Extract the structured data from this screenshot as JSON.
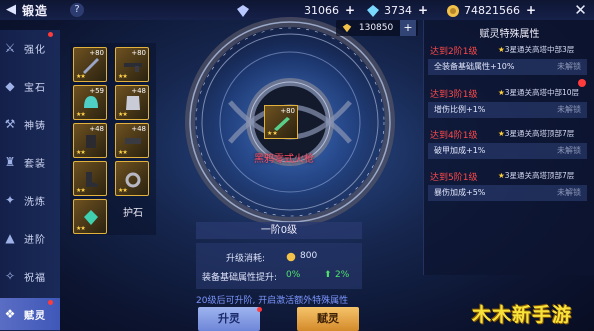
{
  "header": {
    "title": "锻造",
    "help": "?"
  },
  "currencies": [
    {
      "icon": "diamond-icon",
      "value": "31066",
      "color": "#b9c8ff"
    },
    {
      "icon": "gem-icon",
      "value": "3734",
      "color": "#7ad9ff"
    },
    {
      "icon": "coin-icon",
      "value": "74821566",
      "color": "#f2c14a"
    }
  ],
  "secondary_currency": {
    "icon": "diamond-icon",
    "value": "130850"
  },
  "side_menu": [
    {
      "label": "强化",
      "icon": "sword-icon",
      "active": false,
      "dot": true
    },
    {
      "label": "宝石",
      "icon": "gem-icon",
      "active": false,
      "dot": false
    },
    {
      "label": "神铸",
      "icon": "anvil-icon",
      "active": false,
      "dot": false
    },
    {
      "label": "套装",
      "icon": "armor-icon",
      "active": false,
      "dot": false
    },
    {
      "label": "洗炼",
      "icon": "refine-icon",
      "active": false,
      "dot": false
    },
    {
      "label": "进阶",
      "icon": "advance-icon",
      "active": false,
      "dot": false
    },
    {
      "label": "祝福",
      "icon": "bless-icon",
      "active": false,
      "dot": false
    },
    {
      "label": "赋灵",
      "icon": "spirit-icon",
      "active": true,
      "dot": true
    }
  ],
  "items": [
    {
      "level": "+80",
      "stars": "★★"
    },
    {
      "level": "+80",
      "stars": "★★"
    },
    {
      "level": "+59",
      "stars": "★★"
    },
    {
      "level": "+48",
      "stars": "★★"
    },
    {
      "level": "+48",
      "stars": "★★"
    },
    {
      "level": "+48",
      "stars": "★★"
    },
    {
      "level": "",
      "stars": "★★"
    },
    {
      "level": "",
      "stars": "★★"
    },
    {
      "level": "",
      "stars": "★★"
    }
  ],
  "protect_stone": "护石",
  "center": {
    "item_level": "+80",
    "item_stars": "★★",
    "item_name": "黑鸦零式火枪"
  },
  "stage": "一阶0级",
  "cost": {
    "label": "升级消耗:",
    "value": "800",
    "attr_label": "装备基础属性提升:",
    "current": "0%",
    "next": "2%"
  },
  "hint": "20级后可升阶, 开启激活额外特殊属性",
  "buttons": {
    "ascend": "升灵",
    "fuse": "赋灵"
  },
  "right_panel": {
    "title": "赋灵特殊属性",
    "attributes": [
      {
        "tier": "达到2阶1级",
        "condition": "3星通关高塔中部3层",
        "effect": "全装备基础属性+10%",
        "status": "未解锁"
      },
      {
        "tier": "达到3阶1级",
        "condition": "3星通关高塔中部10层",
        "effect": "增伤比例+1%",
        "status": "未解锁"
      },
      {
        "tier": "达到4阶1级",
        "condition": "3星通关高塔顶部7层",
        "effect": "破甲加成+1%",
        "status": "未解锁"
      },
      {
        "tier": "达到5阶1级",
        "condition": "3星通关高塔顶部7层",
        "effect": "暴伤加成+5%",
        "status": "未解锁"
      }
    ]
  },
  "watermark": "木木新手游",
  "colors": {
    "accent_red": "#ff4a4a",
    "accent_green": "#4fe36a",
    "gold": "#e3b23c",
    "hint_blue": "#7b96ff"
  }
}
